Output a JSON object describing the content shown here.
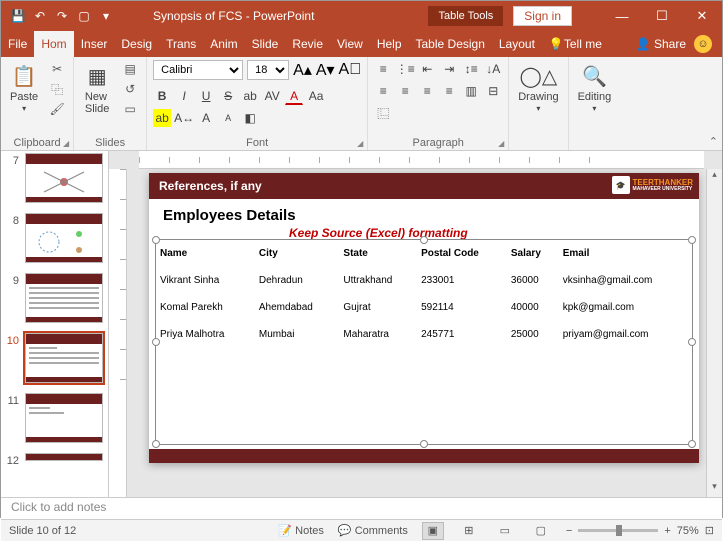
{
  "title": "Synopsis of FCS  -  PowerPoint",
  "tableTools": "Table Tools",
  "signin": "Sign in",
  "tabs": {
    "file": "File",
    "home": "Hom",
    "insert": "Inser",
    "design": "Desig",
    "trans": "Trans",
    "anim": "Anim",
    "slide": "Slide",
    "review": "Revie",
    "view": "View",
    "help": "Help",
    "tdesign": "Table Design",
    "layout": "Layout",
    "tellme": "Tell me",
    "share": "Share"
  },
  "ribbon": {
    "clipboard": "Clipboard",
    "paste": "Paste",
    "slides": "Slides",
    "newslide": "New\nSlide",
    "font": "Font",
    "fontname": "Calibri",
    "fontsize": "18",
    "paragraph": "Paragraph",
    "drawing": "Drawing",
    "editing": "Editing"
  },
  "thumbs": [
    "7",
    "8",
    "9",
    "10",
    "11",
    "12"
  ],
  "slide": {
    "hdr": "References, if any",
    "univ1": "TEERTHANKER",
    "univ2": "MAHAVEER UNIVERSITY",
    "title": "Employees Details",
    "note": "Keep Source (Excel) formatting",
    "headers": [
      "Name",
      "City",
      "State",
      "Postal Code",
      "Salary",
      "Email"
    ],
    "rows": [
      [
        "Vikrant Sinha",
        "Dehradun",
        "Uttrakhand",
        "233001",
        "36000",
        "vksinha@gmail.com"
      ],
      [
        "Komal Parekh",
        "Ahemdabad",
        "Gujrat",
        "592114",
        "40000",
        "kpk@gmail.com"
      ],
      [
        "Priya Malhotra",
        "Mumbai",
        "Maharatra",
        "245771",
        "25000",
        "priyam@gmail.com"
      ]
    ]
  },
  "notes": "Click to add notes",
  "status": {
    "slide": "Slide 10 of 12",
    "notes": "Notes",
    "comments": "Comments",
    "zoom": "75%"
  }
}
